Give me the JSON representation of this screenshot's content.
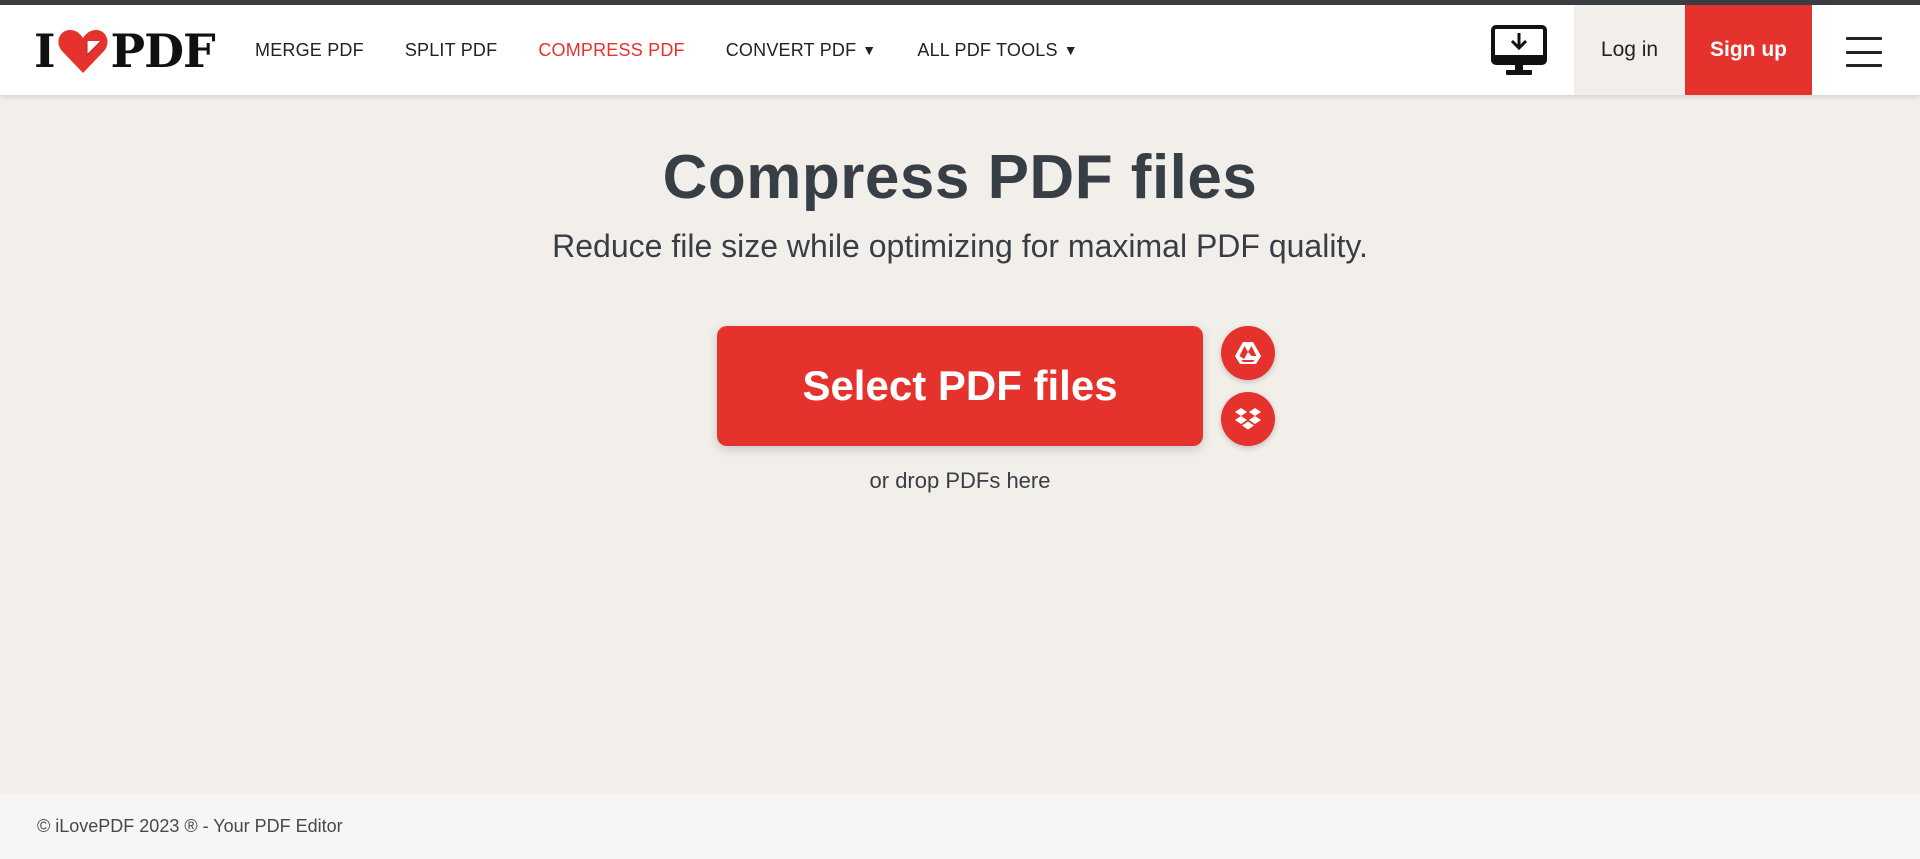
{
  "header": {
    "logo": {
      "left_text": "I",
      "right_text": "PDF",
      "brand_color": "#e5322d"
    },
    "nav": [
      {
        "label": "MERGE PDF",
        "active": false,
        "has_dropdown": false
      },
      {
        "label": "SPLIT PDF",
        "active": false,
        "has_dropdown": false
      },
      {
        "label": "COMPRESS PDF",
        "active": true,
        "has_dropdown": false
      },
      {
        "label": "CONVERT PDF",
        "active": false,
        "has_dropdown": true
      },
      {
        "label": "ALL PDF TOOLS",
        "active": false,
        "has_dropdown": true
      }
    ],
    "dropdown_caret": "▼",
    "desktop_icon": "desktop-download-icon",
    "login_label": "Log in",
    "signup_label": "Sign up",
    "menu_icon": "hamburger-menu-icon"
  },
  "hero": {
    "title": "Compress PDF files",
    "subtitle": "Reduce file size while optimizing for maximal PDF quality.",
    "select_label": "Select PDF files",
    "drop_hint": "or drop PDFs here",
    "cloud_buttons": [
      {
        "icon": "google-drive-icon"
      },
      {
        "icon": "dropbox-icon"
      }
    ]
  },
  "footer": {
    "copyright": "© iLovePDF 2023 ® - Your PDF Editor"
  },
  "colors": {
    "accent": "#e5322d",
    "background": "#f2efeb",
    "text": "#383e45",
    "header_bg": "#ffffff"
  }
}
